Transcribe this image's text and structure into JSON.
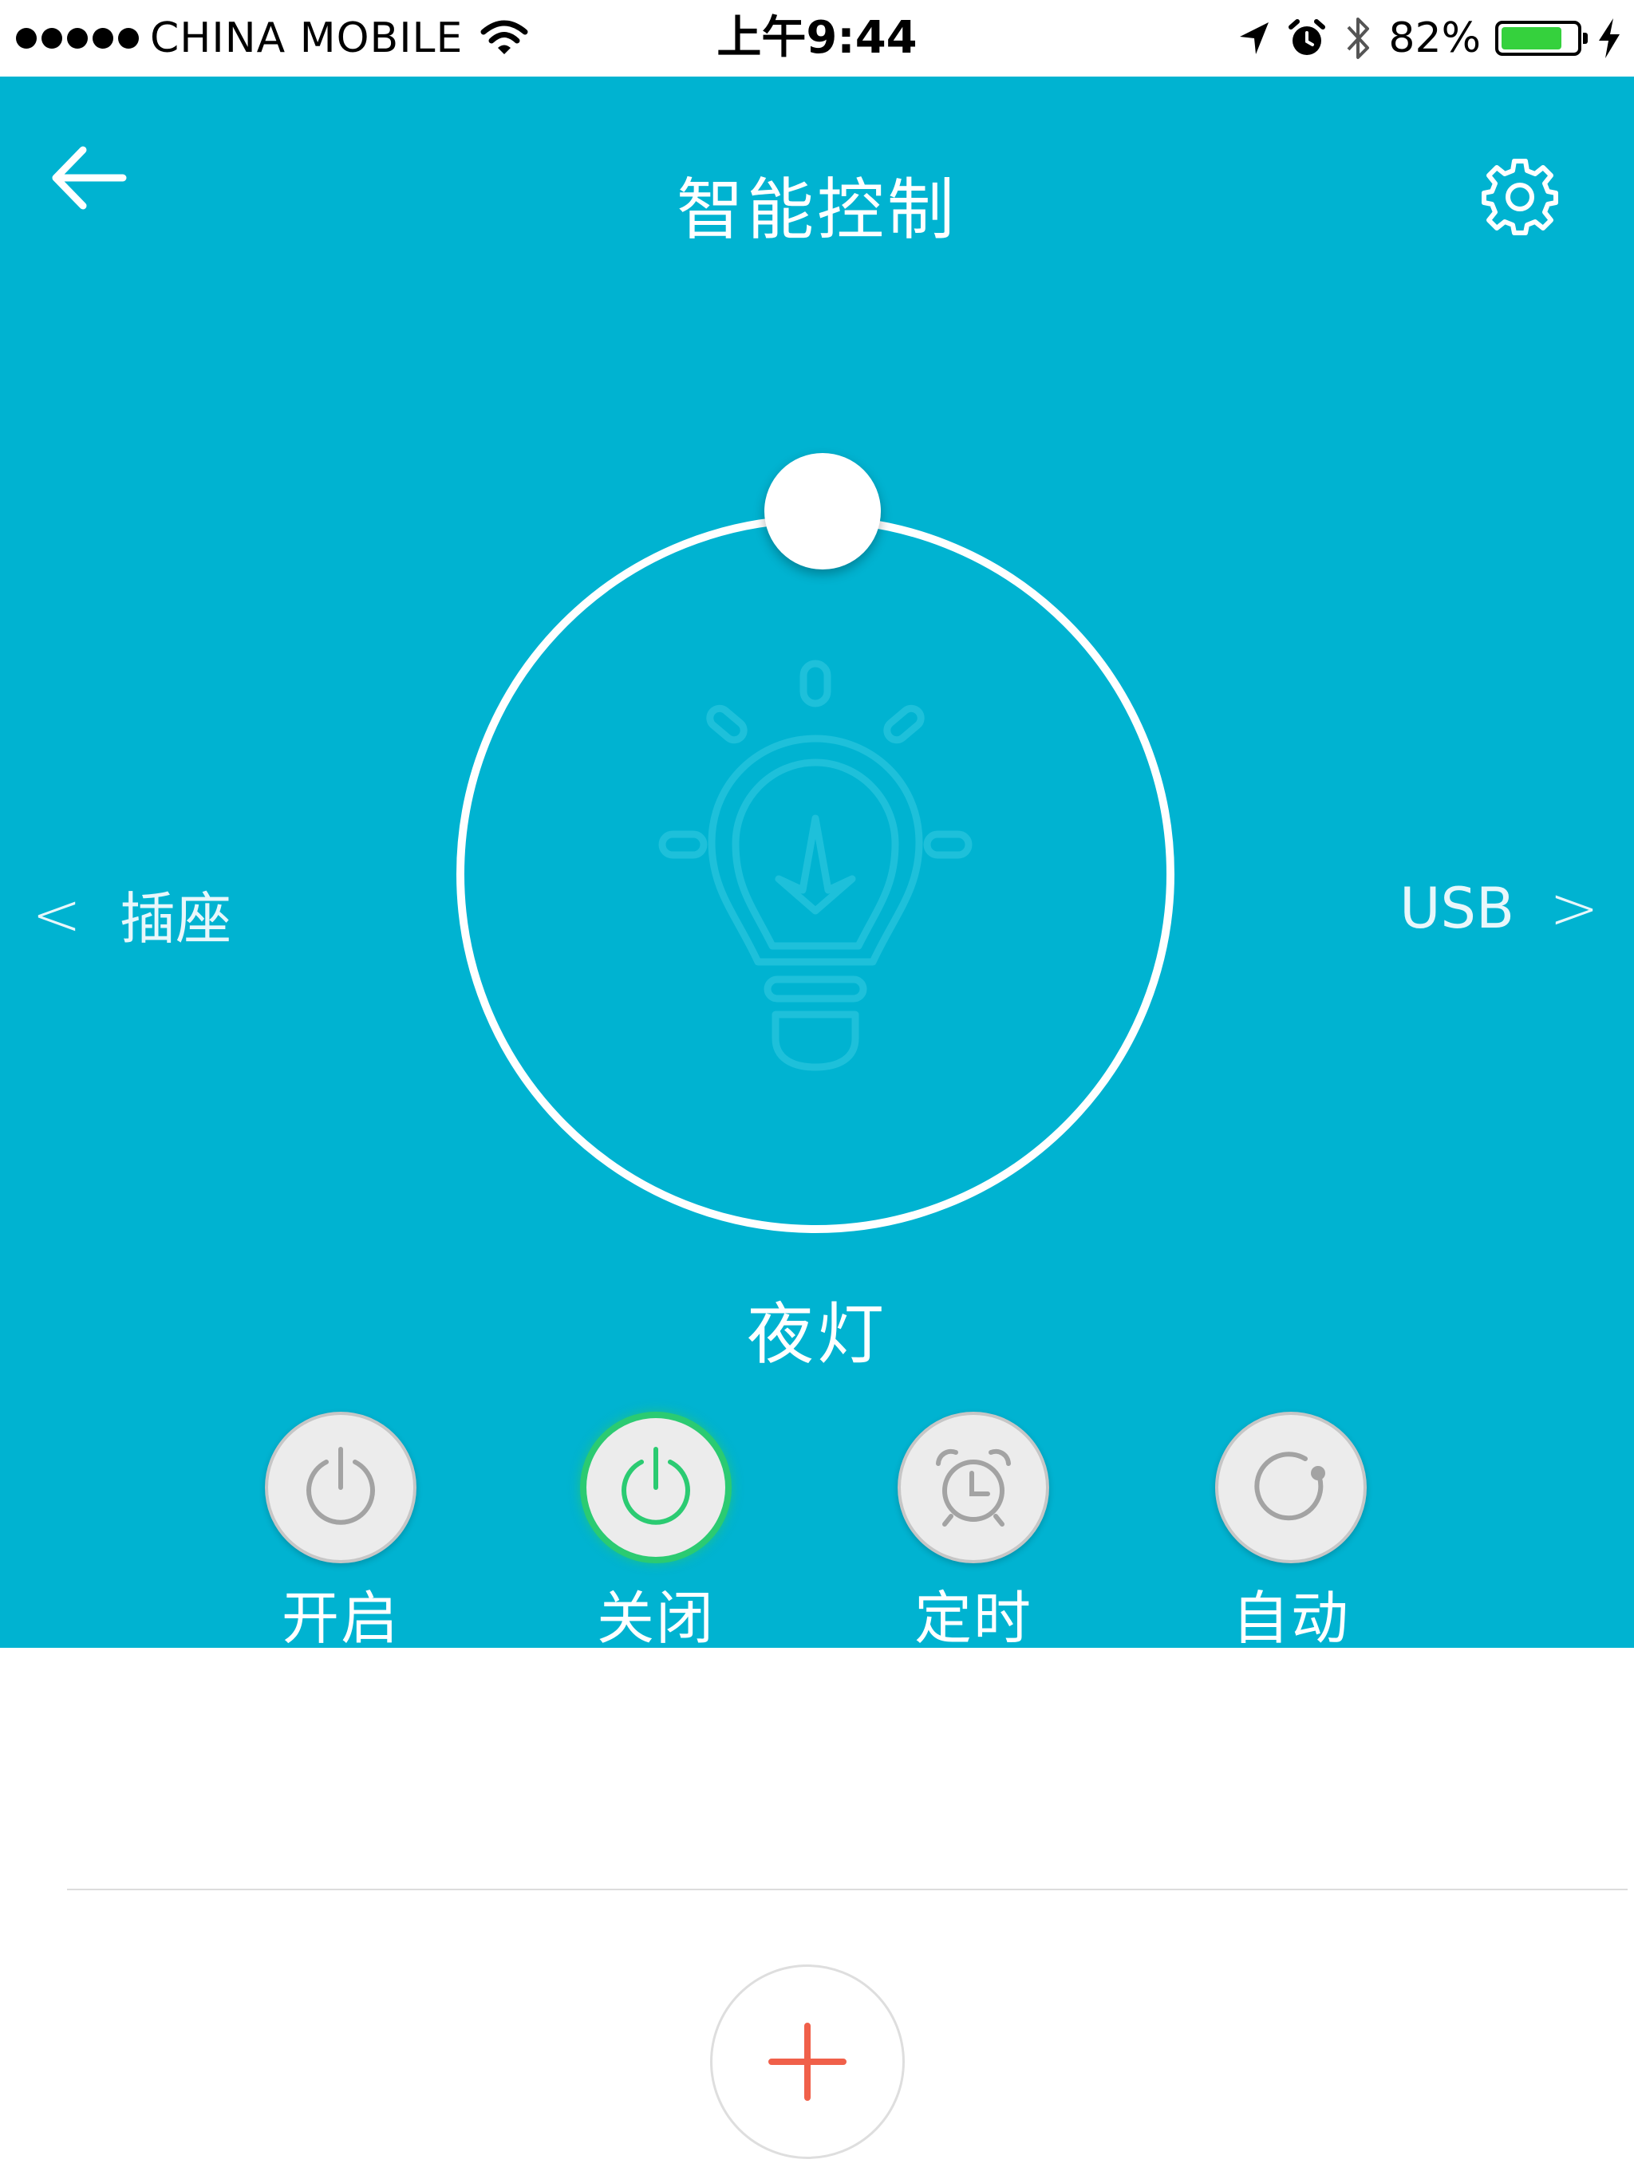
{
  "status_bar": {
    "carrier": "CHINA MOBILE",
    "time": "上午9:44",
    "battery": "82%",
    "battery_level": 0.82,
    "icons": [
      "signal-dots-icon",
      "wifi-icon",
      "location-arrow-icon",
      "alarm-icon",
      "bluetooth-icon",
      "battery-icon",
      "charging-bolt-icon"
    ]
  },
  "header": {
    "title": "智能控制",
    "back_icon": "arrow-left-icon",
    "settings_icon": "gear-icon"
  },
  "control": {
    "center_icon": "light-bulb-icon",
    "prev_label": "插座",
    "next_label": "USB",
    "prev_chevron": "<",
    "next_chevron": ">",
    "mode_name": "夜灯"
  },
  "actions": [
    {
      "label": "开启",
      "icon": "power-icon",
      "active": false
    },
    {
      "label": "关闭",
      "icon": "power-icon",
      "active": true
    },
    {
      "label": "定时",
      "icon": "alarm-clock-icon",
      "active": false
    },
    {
      "label": "自动",
      "icon": "auto-cycle-icon",
      "active": false
    }
  ],
  "bottom": {
    "add_icon": "plus-icon"
  },
  "colors": {
    "primary": "#00b3d1",
    "active_green": "#2bcb72",
    "add_red": "#f0604a",
    "battery_green": "#35d13d"
  }
}
